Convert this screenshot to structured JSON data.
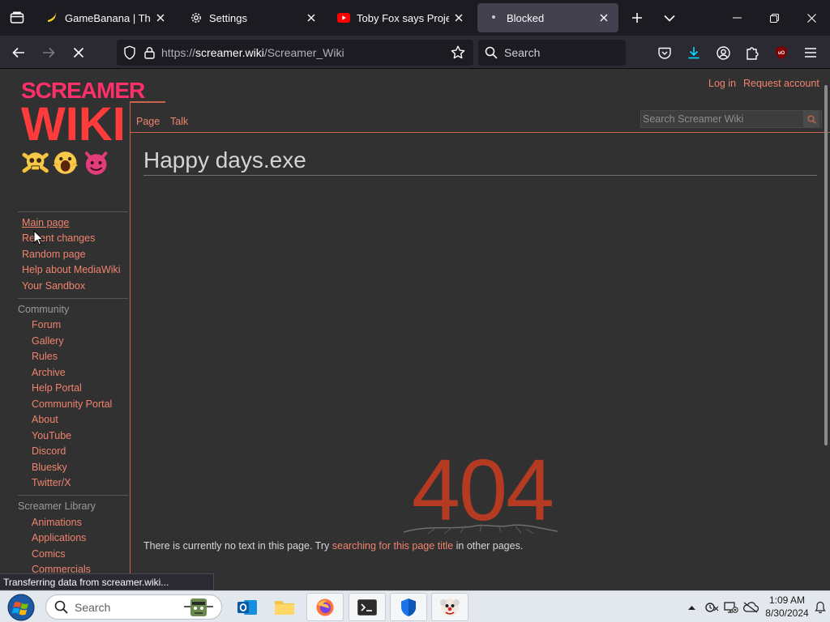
{
  "browser": {
    "tabs": [
      {
        "title": "GameBanana | The Ga",
        "favicon": "banana-icon",
        "active": false
      },
      {
        "title": "Settings",
        "favicon": "gear-icon",
        "active": false
      },
      {
        "title": "Toby Fox says Project",
        "favicon": "youtube-icon",
        "active": false
      },
      {
        "title": "Blocked",
        "favicon": "dot-icon",
        "active": true
      }
    ],
    "url_prefix": "https://",
    "url_domain": "screamer.wiki",
    "url_path": "/Screamer_Wiki",
    "search_placeholder": "Search",
    "status_text": "Transferring data from screamer.wiki..."
  },
  "wiki": {
    "logo_line1": "SCREAMER",
    "logo_line2": "WIKI",
    "personal": {
      "login": "Log in",
      "request": "Request account"
    },
    "page_tabs": {
      "page": "Page",
      "talk": "Talk"
    },
    "search_placeholder": "Search Screamer Wiki",
    "navigation": [
      "Main page",
      "Recent changes",
      "Random page",
      "Help about MediaWiki",
      "Your Sandbox"
    ],
    "community_heading": "Community",
    "community": [
      "Forum",
      "Gallery",
      "Rules",
      "Archive",
      "Help Portal",
      "Community Portal",
      "About",
      "YouTube",
      "Discord",
      "Bluesky",
      "Twitter/X"
    ],
    "library_heading": "Screamer Library",
    "library": [
      "Animations",
      "Applications",
      "Comics",
      "Commercials"
    ],
    "page_title": "Happy days.exe",
    "error_code": "404",
    "message_before": "There is currently no text in this page. Try ",
    "message_link": "searching for this page title",
    "message_after": " in other pages."
  },
  "taskbar": {
    "search_placeholder": "Search",
    "time": "1:09 AM",
    "date": "8/30/2024"
  },
  "colors": {
    "accent_link": "#f0836e",
    "logo_red": "#ff3c48",
    "page_bg": "#313131",
    "browser_bg": "#1c1b22"
  }
}
